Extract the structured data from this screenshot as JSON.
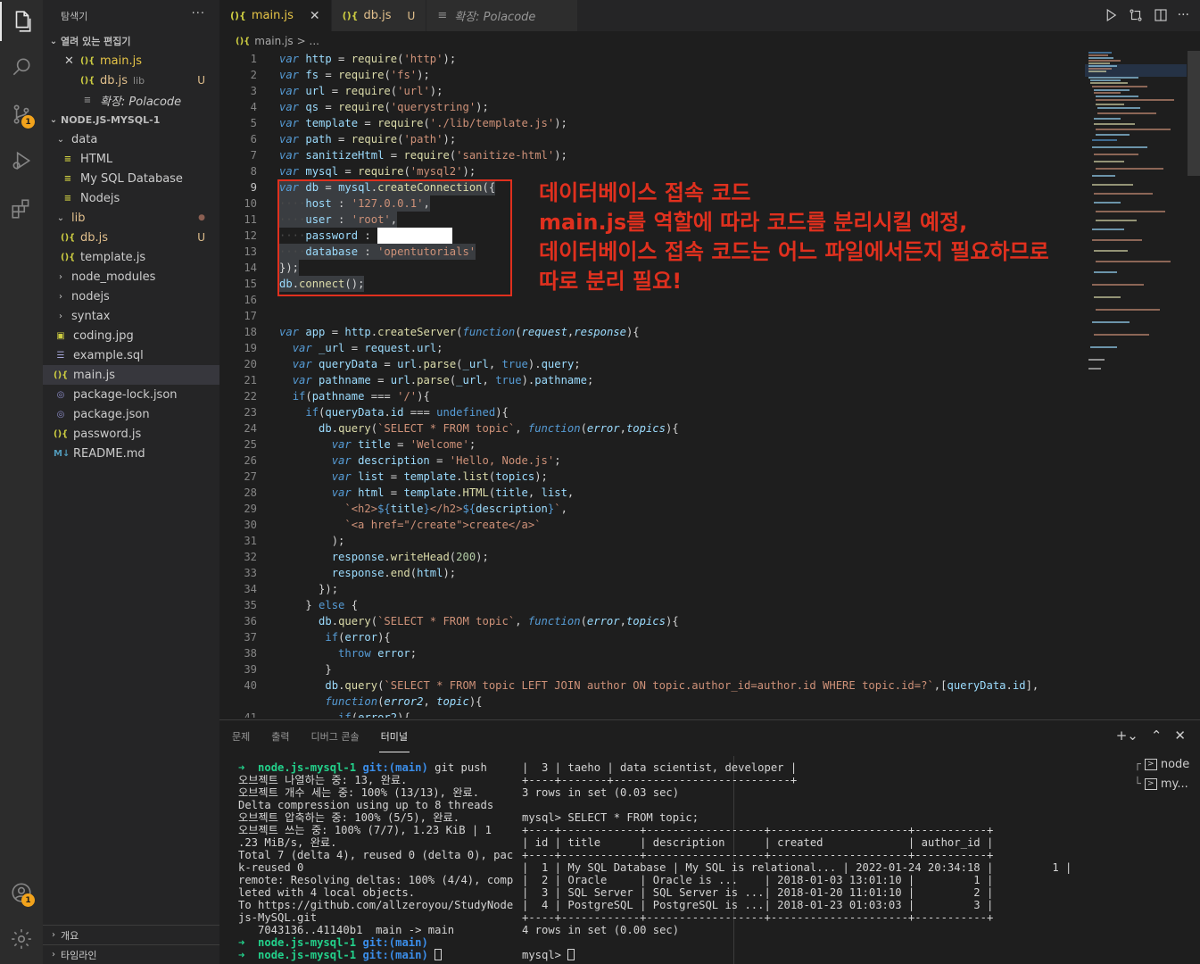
{
  "explorer": {
    "title": "탐색기",
    "open_editors_label": "열려 있는 편집기",
    "open_editors": [
      {
        "label": "main.js",
        "lib": "",
        "status": ""
      },
      {
        "label": "db.js",
        "lib": "lib",
        "status": "U"
      },
      {
        "label": "확장: Polacode",
        "lib": "",
        "status": ""
      }
    ],
    "project_label": "NODE.JS-MYSQL-1",
    "tree": {
      "data": "data",
      "html": "HTML",
      "mysql": "My SQL Database",
      "nodejs": "Nodejs",
      "lib": "lib",
      "db": "db.js",
      "db_status": "U",
      "template": "template.js",
      "node_modules": "node_modules",
      "nodejs_dir": "nodejs",
      "syntax": "syntax",
      "coding": "coding.jpg",
      "example": "example.sql",
      "main": "main.js",
      "package_lock": "package-lock.json",
      "package": "package.json",
      "password": "password.js",
      "readme": "README.md"
    },
    "outline_label": "개요",
    "timeline_label": "타임라인"
  },
  "activity": {
    "source_control_badge": "1",
    "accounts_badge": "1"
  },
  "tabs": [
    {
      "label": "main.js",
      "active": true
    },
    {
      "label": "db.js",
      "status": "U"
    },
    {
      "label": "확장: Polacode"
    }
  ],
  "breadcrumb": {
    "file": "main.js",
    "rest": "> ..."
  },
  "annotation": {
    "lines": [
      "데이터베이스 접속 코드",
      "main.js를 역할에 따라 코드를 분리시킬 예정,",
      "데이터베이스 접속 코드는 어느 파일에서든지 필요하므로",
      "따로 분리 필요!"
    ]
  },
  "code": {
    "line_numbers": [
      "1",
      "2",
      "3",
      "4",
      "5",
      "6",
      "7",
      "8",
      "9",
      "10",
      "11",
      "12",
      "13",
      "14",
      "15",
      "16",
      "17",
      "18",
      "19",
      "20",
      "21",
      "22",
      "23",
      "24",
      "25",
      "26",
      "27",
      "28",
      "29",
      "30",
      "31",
      "32",
      "33",
      "34",
      "35",
      "36",
      "37",
      "38",
      "39",
      "40",
      "",
      "41"
    ],
    "current_line": "9"
  },
  "panel": {
    "tabs": [
      "문제",
      "출력",
      "디버그 콘솔",
      "터미널"
    ],
    "active_tab": "터미널",
    "terminals": [
      "node",
      "my..."
    ],
    "left_terminal": [
      {
        "prompt_dir": "node.js-mysql-1",
        "git": "git:(main)",
        "cmd": "git push"
      },
      "오브젝트 나열하는 중: 13, 완료.",
      "오브젝트 개수 세는 중: 100% (13/13), 완료.",
      "Delta compression using up to 8 threads",
      "오브젝트 압축하는 중: 100% (5/5), 완료.",
      "오브젝트 쓰는 중: 100% (7/7), 1.23 KiB | 1",
      ".23 MiB/s, 완료.",
      "Total 7 (delta 4), reused 0 (delta 0), pac",
      "k-reused 0",
      "remote: Resolving deltas: 100% (4/4), comp",
      "leted with 4 local objects.",
      "To https://github.com/allzeroyou/StudyNode",
      "js-MySQL.git",
      "   7043136..41140b1  main -> main"
    ],
    "right_terminal": [
      "|  3 | taeho | data scientist, developer |",
      "+----+-------+---------------------------+",
      "3 rows in set (0.03 sec)",
      "",
      "mysql> SELECT * FROM topic;",
      "+----+------------+------------------+---------------------+-----------+",
      "| id | title      | description      | created             | author_id |",
      "+----+------------+------------------+---------------------+-----------+",
      "|  1 | My SQL Database | My SQL is relational... | 2022-01-24 20:34:18 |         1 |",
      "|  2 | Oracle     | Oracle is ...    | 2018-01-03 13:01:10 |         1 |",
      "|  3 | SQL Server | SQL Server is ...| 2018-01-20 11:01:10 |         2 |",
      "|  4 | PostgreSQL | PostgreSQL is ...| 2018-01-23 01:03:03 |         3 |",
      "+----+------------+------------------+---------------------+-----------+",
      "4 rows in set (0.00 sec)",
      "",
      "mysql> "
    ]
  }
}
